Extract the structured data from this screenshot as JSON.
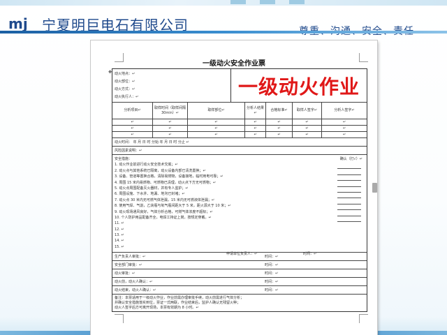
{
  "header": {
    "brand": "mj",
    "company": "宁夏明巨电石有限公司",
    "slogan": "尊重、沟通、安全、责任"
  },
  "document": {
    "title": "一级动火安全作业票",
    "stamp": "一级动火作业",
    "info_lines": [
      "动火地点：↵",
      "动火部位：↵",
      "动火方式：↵",
      "动火执行人：↵"
    ],
    "analysis_header": [
      "分析项目↵",
      "取样时间（取样间隔 30min）↵",
      "取样部位↵",
      "分析人结果↵",
      "合格标准↵",
      "取样人签字↵",
      "分析人签字↵"
    ],
    "analysis_rows": [
      [
        "↵",
        "↵",
        "↵",
        "↵",
        "↵",
        "↵",
        "↵"
      ],
      [
        "↵",
        "↵",
        "↵",
        "↵",
        "↵",
        "↵",
        "↵"
      ],
      [
        "↵",
        "↵",
        "↵",
        "↵",
        "↵",
        "↵",
        "↵"
      ]
    ],
    "fire_time": "动火时间：  年  月  日  时  分始  年  月  日  时  分止  ↵",
    "risk": "风险因素说明：↵",
    "measures_title": "安全措施：",
    "confirm_label": "确认（打√）↵",
    "measures": [
      "1. 动火作业前进行动火安全技术交底；↵",
      "2. 动火点与其他系统已隔离，动火设备内部已清洗置换；↵",
      "3. 设备、管道等置换合格，清除易燃物，设备接地，临时用电可靠；↵",
      "4. 周围 15 米内易燃物、可燃物已清理，动火点下方无可燃物；↵",
      "5. 动火点周围配备灭火器材，并有专人监护；↵",
      "6. 周围设施、下水井、地漏、地沟已封堵；↵",
      "7. 动火点 30 米内无可燃气体泄漏，15 米内无可燃液体泄漏；↵",
      "8. 使用气焊、气割，乙炔瓶与氧气瓶间距大于 5 米，距火源大于 10 米；↵",
      "9. 动火现场通风良好，气体分析合格，可燃气体浓度不超标；↵",
      "10. 个人防护用品配备齐全，电焊工持证上岗，按规定穿戴。↵",
      "11. ↵",
      "12. ↵",
      "13. ↵",
      "14. ↵",
      "15. ↵"
    ],
    "applicant": {
      "label": "申请单位负责人：↵",
      "time": "时间：↵"
    },
    "signatures": [
      {
        "label": "生产负责人审批：↵",
        "time": "时间：↵"
      },
      {
        "label": "安全部门审批：↵",
        "time": "时间：↵"
      },
      {
        "label": "动火审批：↵",
        "time": "时间：↵"
      },
      {
        "label": "动火前，动火人确认：↵",
        "time": "时间：↵"
      },
      {
        "label": "动火结束，动火人确认：↵",
        "time": "时间：↵"
      }
    ],
    "notes": [
      "备注：本票适用于一级动火作业，作业前需办理审批手续，动火前需进行气体分析；",
      "并确认安全措施落实到位，票证一式两联，作业结束后，监护人确认无残留火种；",
      "动火人签字后方可离开现场，本票有效期为 8 小时。↵"
    ]
  }
}
